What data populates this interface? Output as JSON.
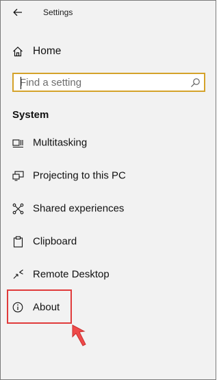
{
  "window": {
    "title": "Settings"
  },
  "nav": {
    "home_label": "Home"
  },
  "search": {
    "placeholder": "Find a setting",
    "value": ""
  },
  "section": {
    "title": "System"
  },
  "items": [
    {
      "label": "Multitasking",
      "icon": "multitasking-icon"
    },
    {
      "label": "Projecting to this PC",
      "icon": "projecting-icon"
    },
    {
      "label": "Shared experiences",
      "icon": "shared-experiences-icon"
    },
    {
      "label": "Clipboard",
      "icon": "clipboard-icon"
    },
    {
      "label": "Remote Desktop",
      "icon": "remote-desktop-icon"
    },
    {
      "label": "About",
      "icon": "info-icon"
    }
  ],
  "colors": {
    "search_border": "#d4a22a",
    "highlight": "#e03a3a",
    "background": "#f2f2f2"
  }
}
